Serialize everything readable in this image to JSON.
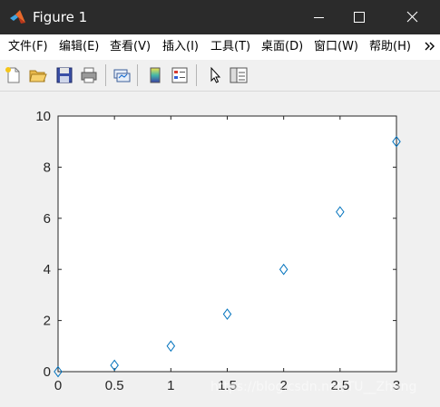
{
  "window": {
    "title": "Figure 1",
    "controls": {
      "minimize_icon": "minimize-icon",
      "maximize_icon": "maximize-icon",
      "close_icon": "close-icon"
    }
  },
  "menu": {
    "items": [
      {
        "label": "文件(F)"
      },
      {
        "label": "编辑(E)"
      },
      {
        "label": "查看(V)"
      },
      {
        "label": "插入(I)"
      },
      {
        "label": "工具(T)"
      },
      {
        "label": "桌面(D)"
      },
      {
        "label": "窗口(W)"
      },
      {
        "label": "帮助(H)"
      }
    ],
    "overflow_icon": "chevron-double-right-icon"
  },
  "toolbar": {
    "buttons": [
      {
        "icon": "new-figure-icon"
      },
      {
        "icon": "open-file-icon"
      },
      {
        "icon": "save-icon"
      },
      {
        "icon": "print-icon"
      },
      {
        "icon": "link-plot-icon"
      },
      {
        "icon": "insert-colorbar-icon"
      },
      {
        "icon": "insert-legend-icon"
      },
      {
        "icon": "edit-plot-cursor-icon"
      },
      {
        "icon": "property-inspector-icon"
      }
    ]
  },
  "colors": {
    "titlebar": "#2b2b2b",
    "marker": "#0072bd",
    "axes_background": "#ffffff",
    "figure_background": "#f0f0f0"
  },
  "chart_data": {
    "type": "scatter",
    "marker": "diamond",
    "x": [
      0,
      0.5,
      1,
      1.5,
      2,
      2.5,
      3
    ],
    "y": [
      0,
      0.25,
      1,
      2.25,
      4,
      6.25,
      9
    ],
    "xlim": [
      0,
      3
    ],
    "ylim": [
      0,
      10
    ],
    "xticks": [
      "0",
      "0.5",
      "1",
      "1.5",
      "2",
      "2.5",
      "3"
    ],
    "yticks": [
      "0",
      "2",
      "4",
      "6",
      "8",
      "10"
    ],
    "grid": false,
    "title": "",
    "xlabel": "",
    "ylabel": ""
  },
  "watermark": "https://blog.csdn.net/TU__Zhang"
}
